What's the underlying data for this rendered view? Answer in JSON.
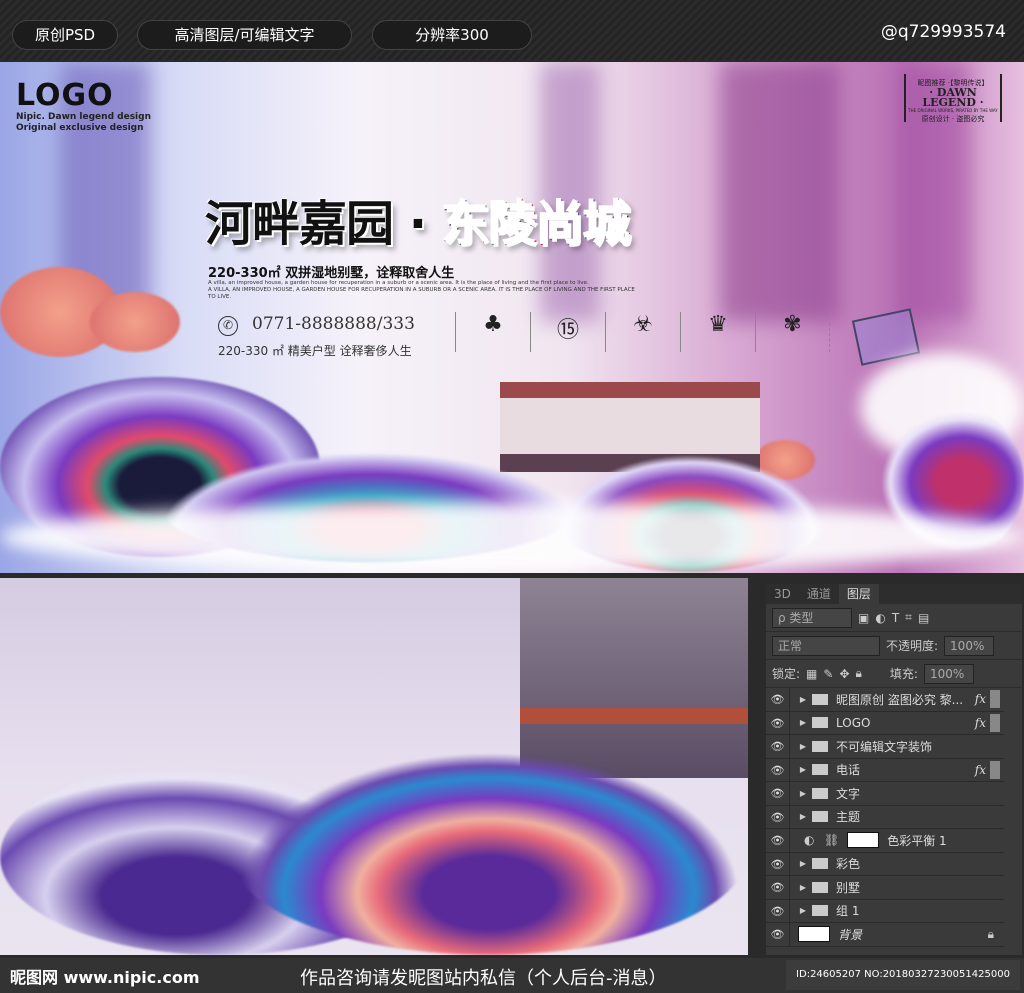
{
  "topbar": {
    "badges": [
      "原创PSD",
      "高清图层/可编辑文字",
      "分辨率300"
    ],
    "author": "@q729993574"
  },
  "banner": {
    "logo": "LOGO",
    "logo_sub1": "Nipic. Dawn legend design",
    "logo_sub2": "Original exclusive design",
    "stamp_top": "昵图推荐 ·【黎明传说】",
    "stamp_main": "· DAWN LEGEND ·",
    "stamp_sub": "THE ORIGINAL WORKS, PIRATED BY THE WAY",
    "stamp_bottom": "原创设计 · 盗图必究",
    "title_a": "河畔嘉园",
    "title_dot": "·",
    "title_b": "东陵尚城",
    "area": "220-330㎡ 双拼湿地别墅，诠释取舍人生",
    "en1": "A villa, an improved house, a garden house for recuperation in a suburb or a scenic area. It is the place of living and the first place to live.",
    "en2": "A VILLA, AN IMPROVED HOUSE, A GARDEN HOUSE FOR RECUPERATION IN A SUBURB OR A SCENIC AREA. IT IS THE PLACE OF LIVING AND THE FIRST PLACE TO LIVE.",
    "phone": "0771-8888888/333",
    "layout": "220-330 ㎡  精美户型 诠释奢侈人生",
    "features": [
      {
        "icon": "tree-icon",
        "glyph": "♣"
      },
      {
        "icon": "badge-15-icon",
        "glyph": "⑮"
      },
      {
        "icon": "biohazard-icon",
        "glyph": "☣"
      },
      {
        "icon": "crown-icon",
        "glyph": "♛"
      },
      {
        "icon": "flower-icon",
        "glyph": "✾"
      }
    ]
  },
  "panel": {
    "tabs": [
      "3D",
      "通道",
      "图层"
    ],
    "filter": "ρ 类型",
    "blend": "正常",
    "opacity_label": "不透明度:",
    "opacity": "100%",
    "lock_label": "锁定:",
    "fill_label": "填充:",
    "fill": "100%",
    "layers": [
      {
        "name": "昵图原创 盗图必究 黎...",
        "fx": "fx"
      },
      {
        "name": "LOGO",
        "fx": "fx"
      },
      {
        "name": "不可编辑文字装饰"
      },
      {
        "name": "电话",
        "fx": "fx"
      },
      {
        "name": "文字"
      },
      {
        "name": "主题"
      },
      {
        "name": "色彩平衡 1"
      },
      {
        "name": "彩色"
      },
      {
        "name": "别墅"
      },
      {
        "name": "组 1"
      },
      {
        "name": "背景"
      }
    ]
  },
  "footer": {
    "site": "昵图网 www.nipic.com",
    "notice": "作品咨询请发昵图站内私信（个人后台-消息）",
    "id": "ID:24605207 NO:20180327230051425000"
  }
}
